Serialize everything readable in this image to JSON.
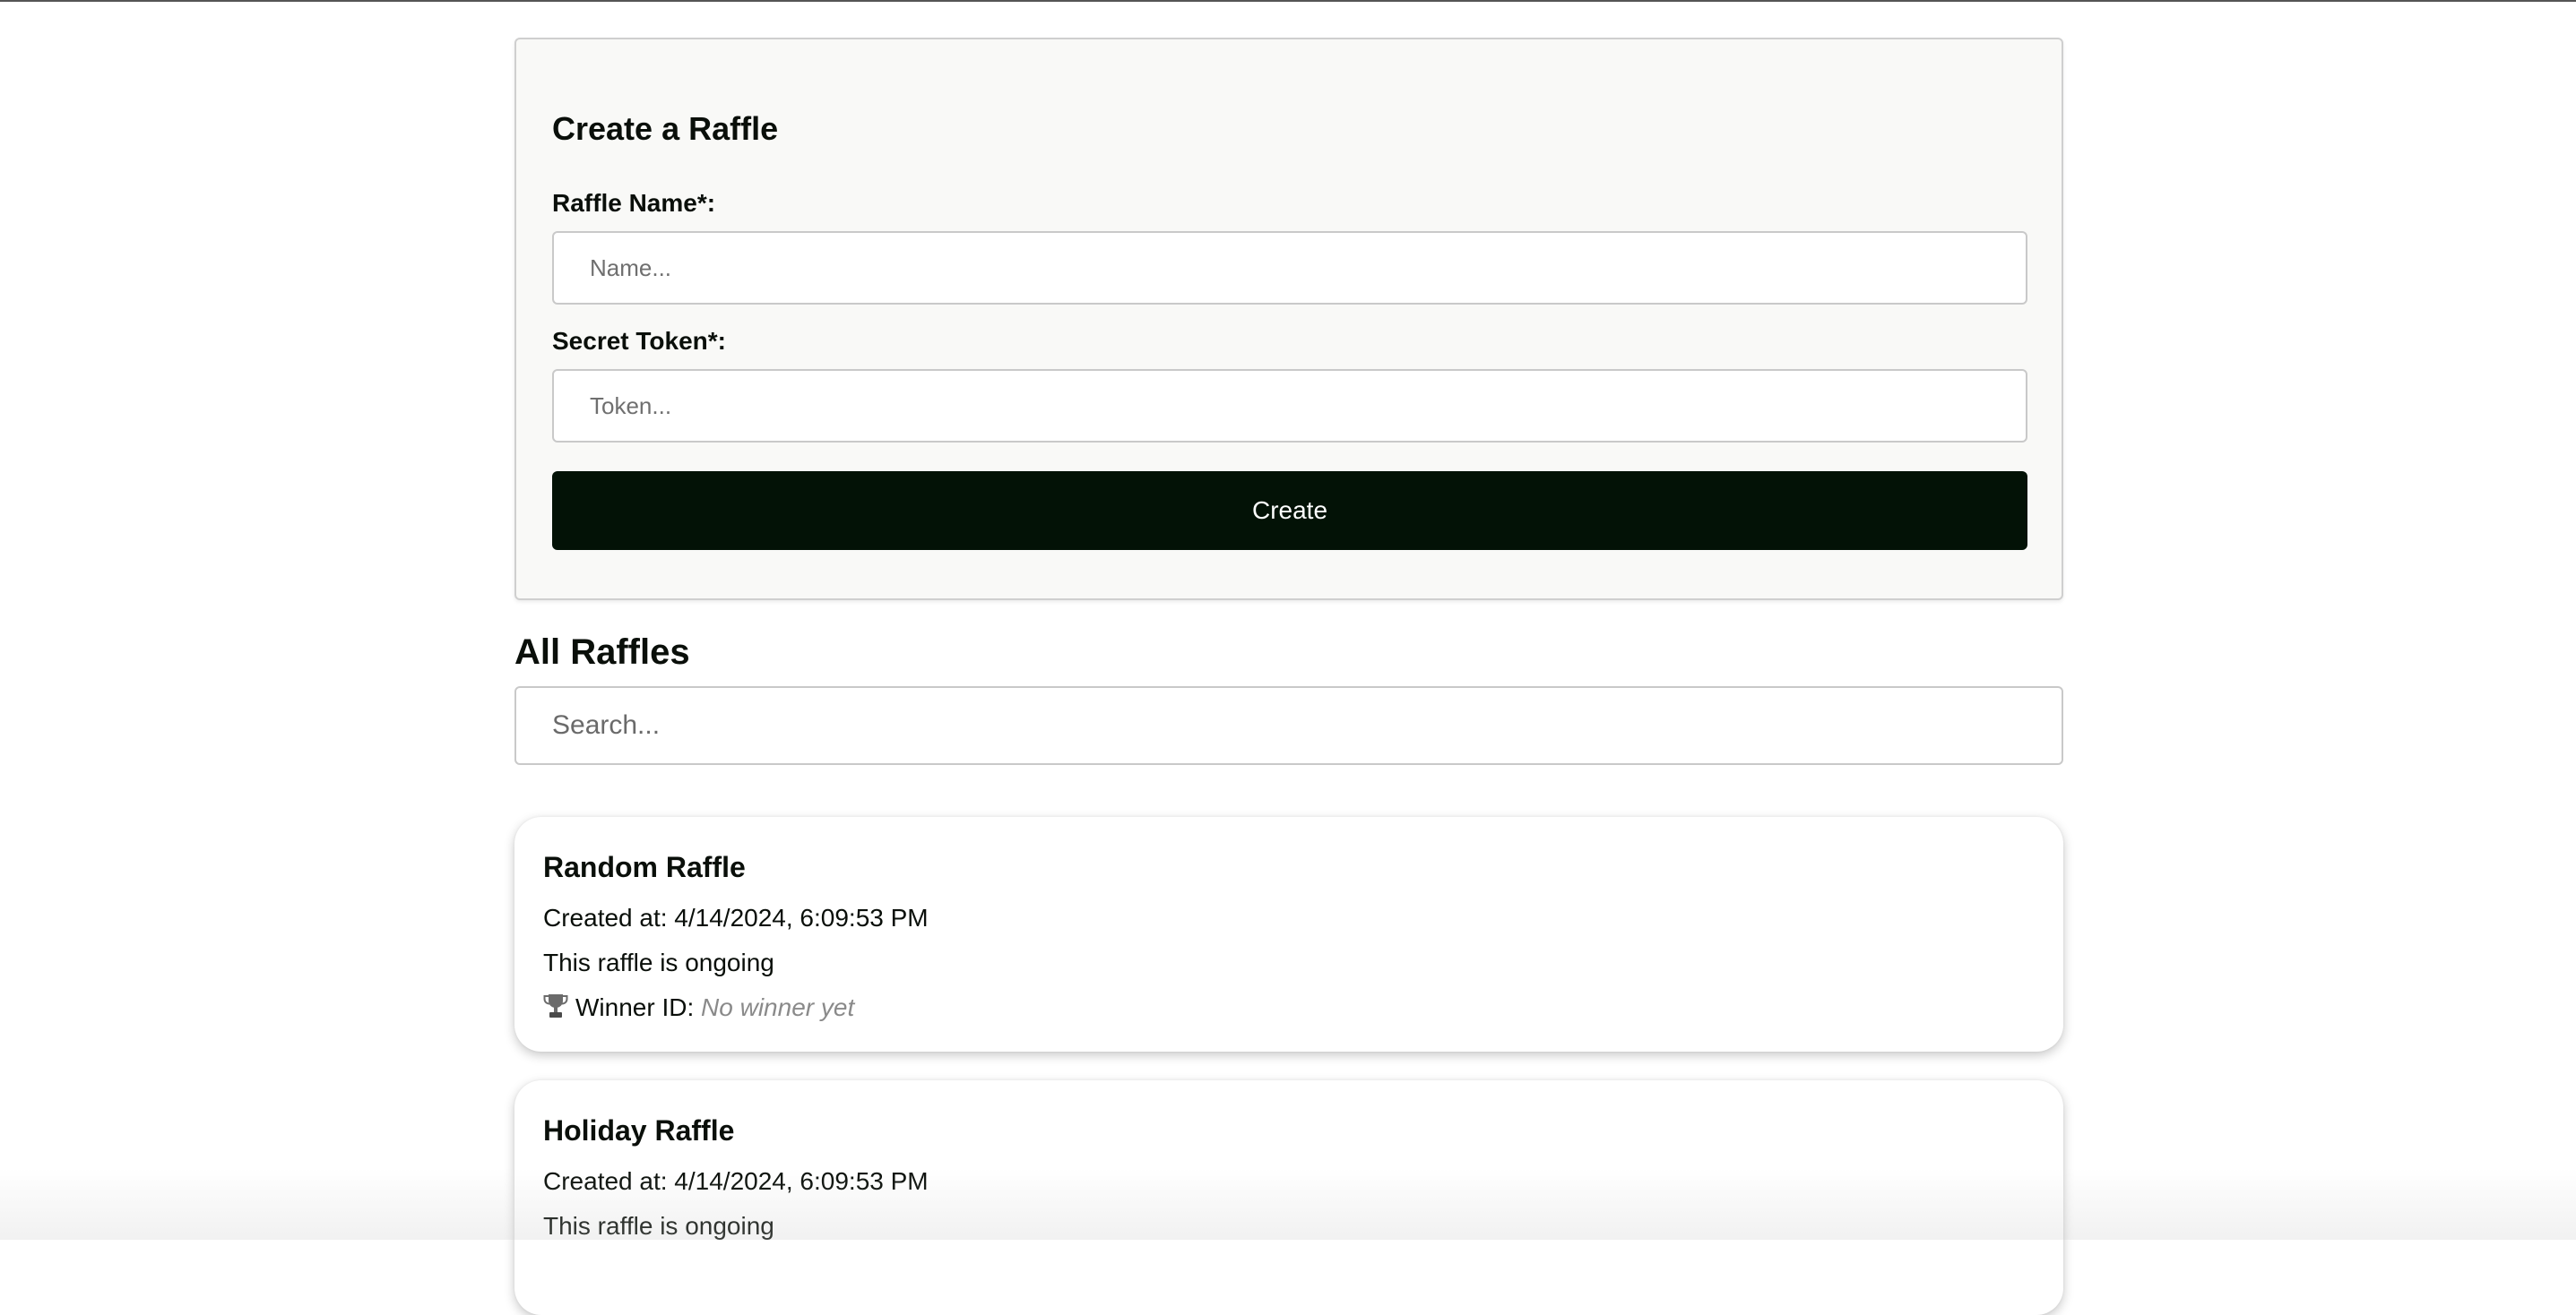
{
  "create_form": {
    "title": "Create a Raffle",
    "name_label": "Raffle Name*:",
    "name_placeholder": "Name...",
    "name_value": "",
    "token_label": "Secret Token*:",
    "token_placeholder": "Token...",
    "token_value": "",
    "submit_label": "Create"
  },
  "raffles_section": {
    "title": "All Raffles",
    "search_placeholder": "Search...",
    "search_value": ""
  },
  "raffles": [
    {
      "name": "Random Raffle",
      "created_at": "Created at: 4/14/2024, 6:09:53 PM",
      "status": "This raffle is ongoing",
      "winner_label": "Winner ID:",
      "winner_value": "No winner yet"
    },
    {
      "name": "Holiday Raffle",
      "created_at": "Created at: 4/14/2024, 6:09:53 PM",
      "status": "This raffle is ongoing"
    }
  ],
  "icons": {
    "winner": "trophy-icon"
  },
  "colors": {
    "primary_button": "#031206",
    "muted_text": "#8a8a8a",
    "form_background": "#f9f9f7"
  }
}
